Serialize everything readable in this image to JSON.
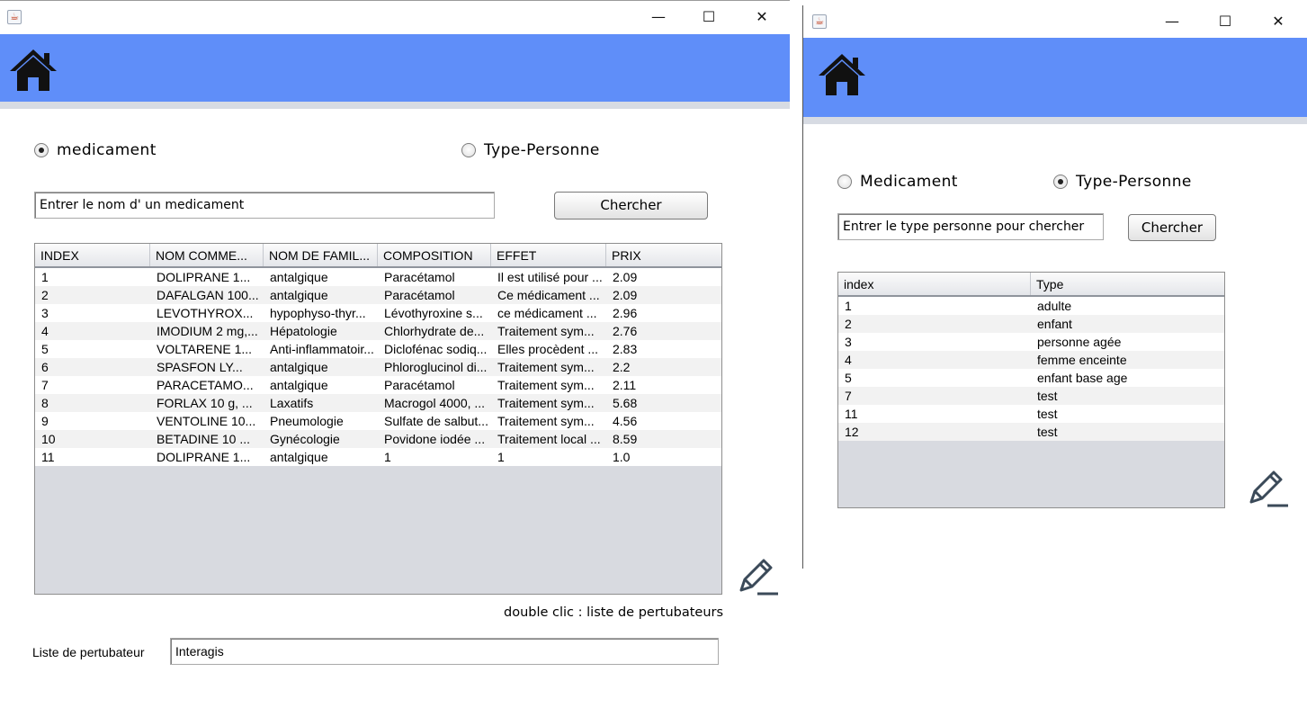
{
  "window_left": {
    "controls": {
      "minimize": "—",
      "maximize": "☐",
      "close": "✕"
    },
    "radios": [
      {
        "label": "medicament",
        "checked": true
      },
      {
        "label": "Type-Personne",
        "checked": false
      }
    ],
    "search": {
      "value": "Entrer le nom d' un medicament",
      "button": "Chercher"
    },
    "table": {
      "columns": [
        "INDEX",
        "NOM COMME...",
        "NOM DE FAMIL...",
        "COMPOSITION",
        "EFFET",
        "PRIX"
      ],
      "rows": [
        [
          "1",
          "DOLIPRANE 1...",
          "antalgique",
          "Paracétamol",
          "Il est utilisé pour ...",
          "2.09"
        ],
        [
          "2",
          "DAFALGAN 100...",
          "antalgique",
          "Paracétamol",
          "Ce médicament ...",
          "2.09"
        ],
        [
          "3",
          "LEVOTHYROX...",
          "hypophyso-thyr...",
          "Lévothyroxine s...",
          "ce médicament ...",
          "2.96"
        ],
        [
          "4",
          "IMODIUM 2 mg,...",
          "Hépatologie",
          "Chlorhydrate de...",
          "Traitement sym...",
          "2.76"
        ],
        [
          "5",
          "VOLTARENE 1...",
          "Anti-inflammatoir...",
          "Diclofénac sodiq...",
          "Elles procèdent ...",
          "2.83"
        ],
        [
          "6",
          "SPASFON LY...",
          "antalgique",
          "Phloroglucinol di...",
          "Traitement sym...",
          "2.2"
        ],
        [
          "7",
          "PARACETAMO...",
          "antalgique",
          "Paracétamol",
          "Traitement sym...",
          "2.11"
        ],
        [
          "8",
          "FORLAX 10 g, ...",
          "Laxatifs",
          "Macrogol 4000, ...",
          "Traitement sym...",
          "5.68"
        ],
        [
          "9",
          "VENTOLINE 10...",
          "Pneumologie",
          "Sulfate de salbut...",
          " Traitement sym...",
          "4.56"
        ],
        [
          "10",
          "BETADINE 10 ...",
          "Gynécologie",
          "Povidone iodée ...",
          "Traitement local ...",
          "8.59"
        ],
        [
          "11",
          "DOLIPRANE 1...",
          "antalgique",
          "1",
          "1",
          "1.0"
        ]
      ]
    },
    "hint": "double clic : liste de pertubateurs",
    "perturbateur": {
      "label": "Liste de pertubateur",
      "value": "Interagis"
    }
  },
  "window_right": {
    "controls": {
      "minimize": "—",
      "maximize": "☐",
      "close": "✕"
    },
    "radios": [
      {
        "label": "Medicament",
        "checked": false
      },
      {
        "label": "Type-Personne",
        "checked": true
      }
    ],
    "search": {
      "value": "Entrer le type personne pour chercher",
      "button": "Chercher"
    },
    "table": {
      "columns": [
        "index",
        "Type"
      ],
      "rows": [
        [
          "1",
          "adulte"
        ],
        [
          "2",
          "enfant"
        ],
        [
          "3",
          "personne agée"
        ],
        [
          "4",
          "femme enceinte"
        ],
        [
          "5",
          "enfant base age"
        ],
        [
          "7",
          "test"
        ],
        [
          "11",
          "test"
        ],
        [
          "12",
          "test"
        ]
      ]
    }
  },
  "icons": {
    "app": "java-app-icon",
    "home": "home-icon",
    "edit": "pencil-edit-icon",
    "header_color": "#5f8ef9"
  }
}
